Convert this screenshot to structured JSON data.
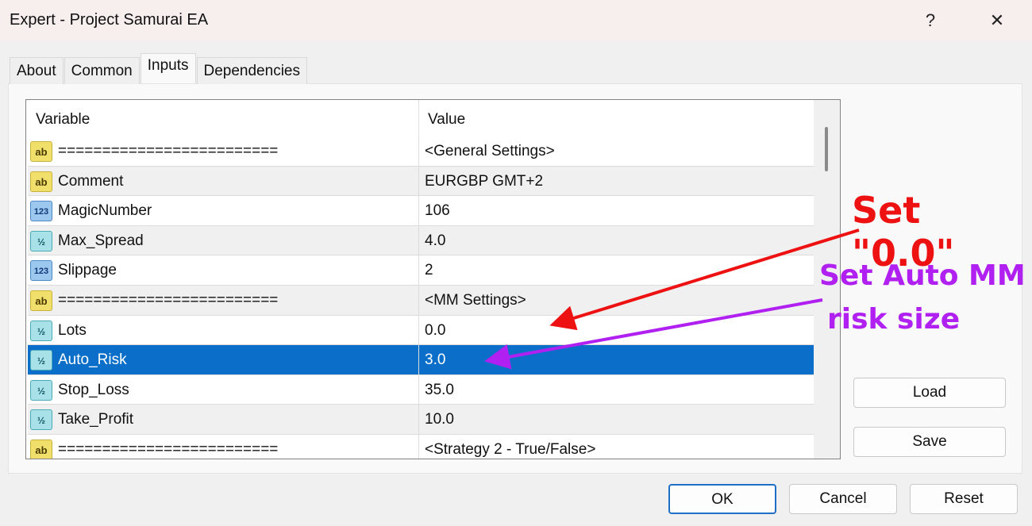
{
  "window": {
    "title": "Expert - Project Samurai EA",
    "help": "?",
    "close": "✕"
  },
  "tabs": [
    {
      "label": "About"
    },
    {
      "label": "Common"
    },
    {
      "label": "Inputs",
      "active": true
    },
    {
      "label": "Dependencies"
    }
  ],
  "grid": {
    "headers": {
      "variable": "Variable",
      "value": "Value"
    },
    "rows": [
      {
        "icon": "ab",
        "var": "=========================",
        "val": "<General Settings>"
      },
      {
        "icon": "ab",
        "var": "Comment",
        "val": "EURGBP GMT+2"
      },
      {
        "icon": "123",
        "var": "MagicNumber",
        "val": "106"
      },
      {
        "icon": "1/2",
        "var": "Max_Spread",
        "val": "4.0"
      },
      {
        "icon": "123",
        "var": "Slippage",
        "val": "2"
      },
      {
        "icon": "ab",
        "var": "=========================",
        "val": "<MM Settings>"
      },
      {
        "icon": "1/2",
        "var": "Lots",
        "val": "0.0"
      },
      {
        "icon": "1/2",
        "var": "Auto_Risk",
        "val": "3.0",
        "selected": true
      },
      {
        "icon": "1/2",
        "var": "Stop_Loss",
        "val": "35.0"
      },
      {
        "icon": "1/2",
        "var": "Take_Profit",
        "val": "10.0"
      },
      {
        "icon": "ab",
        "var": "=========================",
        "val": "<Strategy 2 - True/False>"
      }
    ]
  },
  "buttons": {
    "load": "Load",
    "save": "Save",
    "ok": "OK",
    "cancel": "Cancel",
    "reset": "Reset"
  },
  "annotations": {
    "red": {
      "text": "Set \"0.0\"",
      "color": "#ee1111"
    },
    "purple": {
      "line1": "Set Auto MM",
      "line2": "risk size",
      "color": "#b020f0"
    }
  }
}
